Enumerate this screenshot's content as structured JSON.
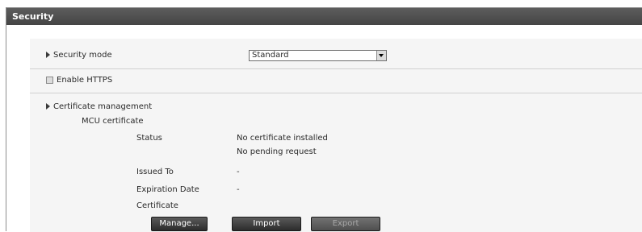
{
  "panel": {
    "title": "Security"
  },
  "security_mode": {
    "label": "Security mode",
    "selected": "Standard"
  },
  "https": {
    "label": "Enable HTTPS",
    "checked": false
  },
  "certificate": {
    "section_label": "Certificate management",
    "subheading": "MCU certificate",
    "status_label": "Status",
    "status_line1": "No certificate installed",
    "status_line2": "No pending request",
    "issued_to_label": "Issued To",
    "issued_to_value": "-",
    "expiration_label": "Expiration Date",
    "expiration_value": "-",
    "certificate_label": "Certificate"
  },
  "buttons": {
    "manage": "Manage...",
    "import": "Import",
    "export": "Export"
  },
  "icons": {
    "section_expander": "chevron-right-icon",
    "dropdown": "chevron-down-icon"
  },
  "colors": {
    "titlebar": "#4f4f4f",
    "content_bg": "#f5f5f5",
    "button": "#3a3a3a"
  }
}
